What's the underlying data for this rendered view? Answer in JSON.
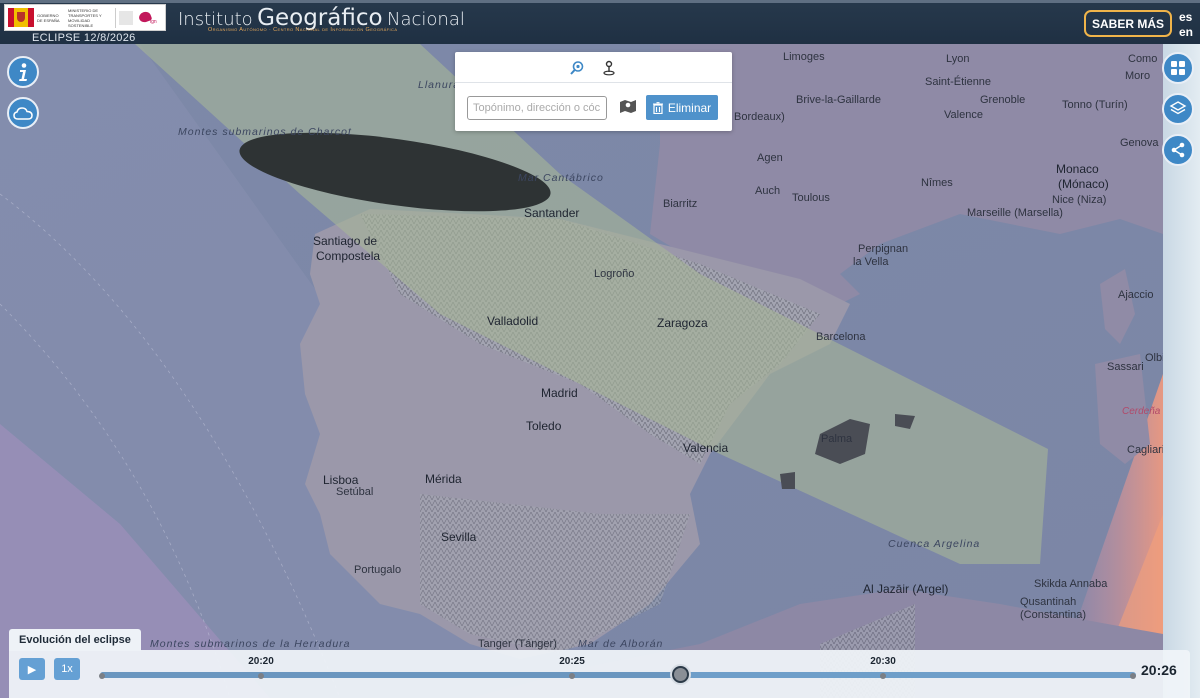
{
  "header": {
    "gov_logo_text": "GOBIERNO DE ESPAÑA",
    "ministry_text": "MINISTERIO DE TRANSPORTES Y MOVILIDAD SOSTENIBLE",
    "ign_text": "ign",
    "eclipse_date": "ECLIPSE 12/8/2026",
    "title_word1": "Instituto",
    "title_word2": "Geográfico",
    "title_word3": "Nacional",
    "subtitle": "Organismo Autónomo · Centro Nacional de Información Geográfica",
    "saber_mas": "SABER MÁS",
    "lang_es": "es",
    "lang_en": "en"
  },
  "search": {
    "placeholder": "Topónimo, dirección o cóc",
    "delete_label": "Eliminar"
  },
  "map": {
    "labels": {
      "llanura": "Llanura",
      "montes_charcot": "Montes submarinos de Charcot",
      "mar_cantabrico": "Mar Cantábrico",
      "santander": "Santander",
      "santiago": "Santiago de",
      "compostela": "Compostela",
      "valladolid": "Valladolid",
      "zaragoza": "Zaragoza",
      "logrono": "Logroño",
      "madrid": "Madrid",
      "toledo": "Toledo",
      "merida": "Mérida",
      "lisboa": "Lisboa",
      "setubal": "Setúbal",
      "portugalo": "Portugalo",
      "sevilla": "Sevilla",
      "valencia": "Valencia",
      "barcelona": "Barcelona",
      "perpignan": "Perpignan",
      "la_vella": "la Vella",
      "biarritz": "Biarritz",
      "auch": "Auch",
      "agen": "Agen",
      "bordeaux": "Bordeaux)",
      "limoges": "Limoges",
      "brive": "Brive-la-Gaillarde",
      "lyon": "Lyon",
      "saint_etienne": "Saint-Étienne",
      "grenoble": "Grenoble",
      "valence": "Valence",
      "nimes": "Nîmes",
      "marseille": "Marseille (Marsella)",
      "monaco": "Monaco",
      "monaco2": "(Mónaco)",
      "nice": "Nice (Niza)",
      "genova": "Genova",
      "torino": "Tonno (Turín)",
      "como": "Como",
      "ajaccio": "Ajaccio",
      "olbia": "Olbia",
      "sassari": "Sassari",
      "cagliari": "Cagliari",
      "cerdena": "Cerdeña",
      "palma": "Palma",
      "cuenca_argelina": "Cuenca Argelina",
      "alger": "Al Jazāir (Argel)",
      "skikda": "Skikda  Annaba",
      "qusantinah": "Qusantinah",
      "constantina": "(Constantina)",
      "montes_herradura": "Montes submarinos de la Herradura",
      "mar_alboran": "Mar de Alborán",
      "tanger": "Tanger (Tánger)",
      "toulouse": "Toulous",
      "moro": "Moro"
    }
  },
  "timeline": {
    "title": "Evolución del eclipse",
    "play_label": "▶",
    "speed_label": "1x",
    "ticks": [
      "20:20",
      "20:25",
      "20:30"
    ],
    "current_time": "20:26",
    "progress": 0.56
  },
  "colors": {
    "header_bg": "#22344a",
    "accent_orange": "#f0b44a",
    "button_blue": "#3e88c6",
    "totality_band": "#8e9a86",
    "umbra": "#2e3334"
  }
}
